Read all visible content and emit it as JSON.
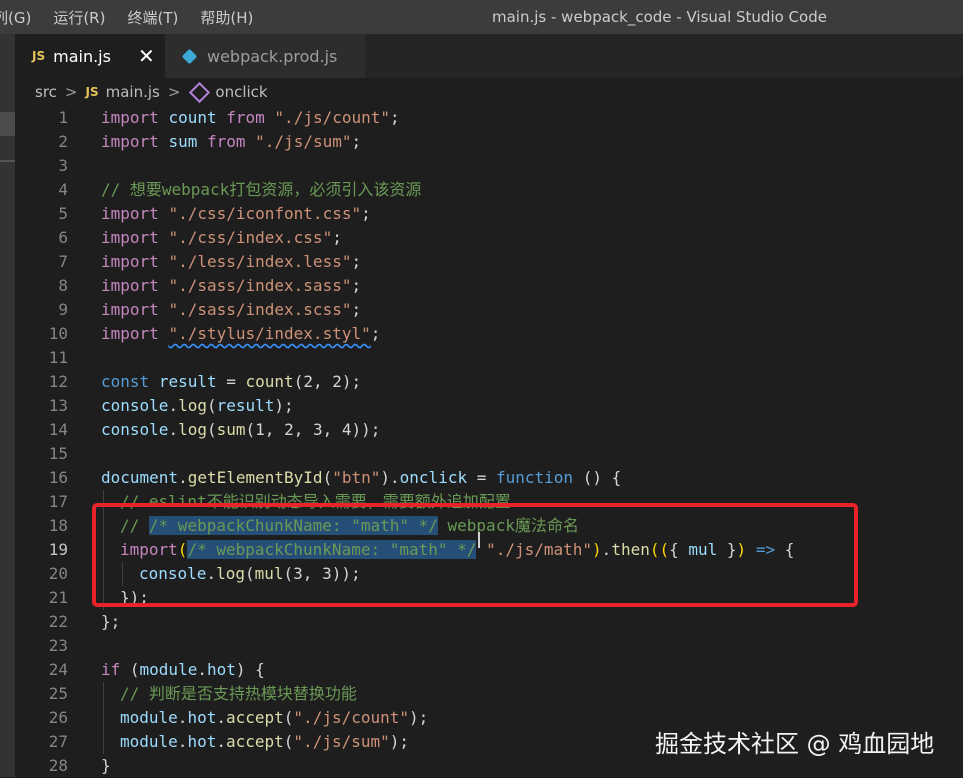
{
  "menu": [
    "列(G)",
    "运行(R)",
    "终端(T)",
    "帮助(H)"
  ],
  "window_title": "main.js - webpack_code - Visual Studio Code",
  "tabs": [
    {
      "badge": "JS",
      "label": "main.js",
      "close": "✕"
    },
    {
      "label": "webpack.prod.js"
    }
  ],
  "breadcrumb": {
    "folder": "src",
    "sep": ">",
    "badge": "JS",
    "file": "main.js",
    "symbol": "onclick"
  },
  "code": {
    "line_numbers": [
      "1",
      "2",
      "3",
      "4",
      "5",
      "6",
      "7",
      "8",
      "9",
      "10",
      "11",
      "12",
      "13",
      "14",
      "15",
      "16",
      "17",
      "18",
      "19",
      "20",
      "21",
      "22",
      "23",
      "24",
      "25",
      "26",
      "27",
      "28"
    ],
    "line1": {
      "kw": "import",
      "id": "count",
      "from": "from",
      "str": "\"./js/count\"",
      "end": ";"
    },
    "line2": {
      "kw": "import",
      "id": "sum",
      "from": "from",
      "str": "\"./js/sum\"",
      "end": ";"
    },
    "line4": "// 想要webpack打包资源，必须引入该资源",
    "line5": {
      "kw": "import",
      "str": "\"./css/iconfont.css\"",
      "end": ";"
    },
    "line6": {
      "kw": "import",
      "str": "\"./css/index.css\"",
      "end": ";"
    },
    "line7": {
      "kw": "import",
      "str": "\"./less/index.less\"",
      "end": ";"
    },
    "line8": {
      "kw": "import",
      "str": "\"./sass/index.sass\"",
      "end": ";"
    },
    "line9": {
      "kw": "import",
      "str": "\"./sass/index.scss\"",
      "end": ";"
    },
    "line10": {
      "kw": "import",
      "str": "\"./stylus/index.styl\"",
      "end": ";"
    },
    "line12": {
      "kw": "const",
      "var": "result",
      "eq": " = ",
      "fn": "count",
      "args": "(2, 2)",
      "end": ";"
    },
    "line13": {
      "obj": "console",
      "dot": ".",
      "fn": "log",
      "open": "(",
      "arg": "result",
      "close": ");"
    },
    "line14": {
      "obj": "console",
      "dot": ".",
      "fn": "log",
      "open": "(",
      "fn2": "sum",
      "args": "(1, 2, 3, 4)",
      "close": ");"
    },
    "line16": {
      "obj": "document",
      "dot": ".",
      "fn": "getElementById",
      "open": "(",
      "str": "\"btn\"",
      "close": ")",
      "dot2": ".",
      "prop": "onclick",
      "eq": " = ",
      "kw": "function",
      "rest": " () {"
    },
    "line17": "// eslint不能识别动态导入需要，需要额外追加配置",
    "line18_prefix": "// ",
    "line18_selected": "/* webpackChunkName: \"math\" */",
    "line18_suffix": " webpack魔法命名",
    "line19": {
      "kw": "import",
      "open": "(",
      "selected": "/* webpackChunkName: \"math\" */",
      "space": " ",
      "str": "\"./js/math\"",
      "close": ")",
      "dot": ".",
      "fn": "then",
      "p1": "((",
      "brace": "{ ",
      "param": "mul",
      "brace2": " }",
      "p2": ")",
      "arrow": " => ",
      "cb": "{"
    },
    "line20": {
      "obj": "console",
      "dot": ".",
      "fn": "log",
      "open": "(",
      "fn2": "mul",
      "args": "(3, 3)",
      "close": ");"
    },
    "line21": {
      "close": "})",
      "end": ";"
    },
    "line22": {
      "close": "}",
      "end": ";"
    },
    "line24": {
      "kw": "if",
      "open": " (",
      "obj": "module",
      "dot": ".",
      "prop": "hot",
      "close": ")",
      "rest": " {"
    },
    "line25": "// 判断是否支持热模块替换功能",
    "line26": {
      "obj": "module",
      "dot": ".",
      "prop": "hot",
      "dot2": ".",
      "fn": "accept",
      "open": "(",
      "str": "\"./js/count\"",
      "close": ");"
    },
    "line27": {
      "obj": "module",
      "dot": ".",
      "prop": "hot",
      "dot2": ".",
      "fn": "accept",
      "open": "(",
      "str": "\"./js/sum\"",
      "close": ");"
    },
    "line28": "}"
  },
  "watermark": "掘金技术社区 @ 鸡血园地",
  "colors": {
    "highlight_box": "#e8232a",
    "selection": "#264f78"
  }
}
